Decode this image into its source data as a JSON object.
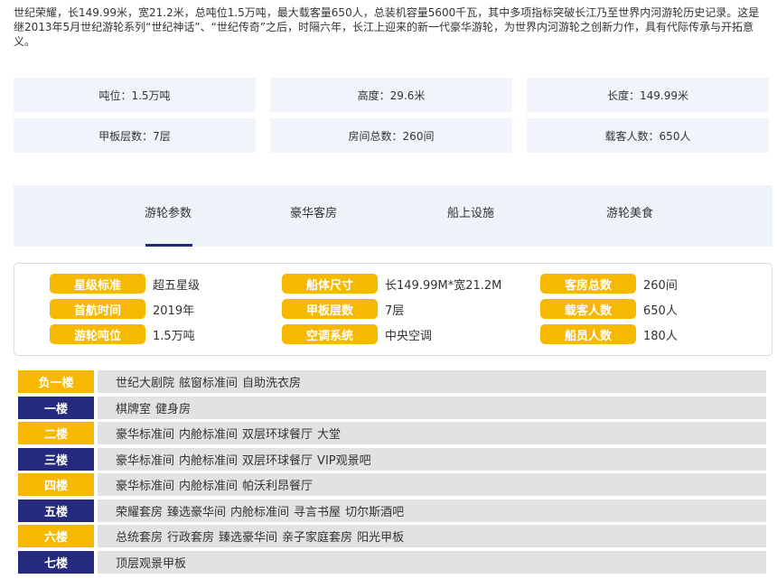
{
  "intro": {
    "text": "世纪荣耀，长149.99米，宽21.2米，总吨位1.5万吨，最大载客量650人，总装机容量5600千瓦，其中多项指标突破长江乃至世界内河游轮历史记录。这是继2013年5月世纪游轮系列“世纪神话”、“世纪传奇”之后，时隔六年，长江上迎来的新一代豪华游轮，为世界内河游轮之创新力作，具有代际传承与开拓意义。"
  },
  "stats": [
    "吨位：1.5万吨",
    "高度：29.6米",
    "长度：149.99米",
    "甲板层数：7层",
    "房间总数：260间",
    "载客人数：650人"
  ],
  "tabs": [
    {
      "label": "游轮参数",
      "active": true
    },
    {
      "label": "豪华客房",
      "active": false
    },
    {
      "label": "船上设施",
      "active": false
    },
    {
      "label": "游轮美食",
      "active": false
    }
  ],
  "specs": [
    {
      "label": "星级标准",
      "value": "超五星级"
    },
    {
      "label": "船体尺寸",
      "value": "长149.99M*宽21.2M"
    },
    {
      "label": "客房总数",
      "value": "260间"
    },
    {
      "label": "首航时间",
      "value": "2019年"
    },
    {
      "label": "甲板层数",
      "value": "7层"
    },
    {
      "label": "载客人数",
      "value": "650人"
    },
    {
      "label": "游轮吨位",
      "value": "1.5万吨"
    },
    {
      "label": "空调系统",
      "value": "中央空调"
    },
    {
      "label": "船员人数",
      "value": "180人"
    }
  ],
  "colors": {
    "gold": "#f6b800",
    "navy": "#252a7e",
    "tab_bg": "#eef3fa",
    "stat_bg": "#f1f5fb",
    "row_bg": "#e2e2e2"
  },
  "decks": [
    {
      "floor": "负一楼",
      "color": "#f6b800",
      "rooms": [
        "世纪大剧院",
        "舷窗标准间",
        "自助洗衣房"
      ]
    },
    {
      "floor": "一楼",
      "color": "#252a7e",
      "rooms": [
        "棋牌室",
        "健身房"
      ]
    },
    {
      "floor": "二楼",
      "color": "#f6b800",
      "rooms": [
        "豪华标准间",
        "内舱标准间",
        "双层环球餐厅",
        "大堂"
      ]
    },
    {
      "floor": "三楼",
      "color": "#252a7e",
      "rooms": [
        "豪华标准间",
        "内舱标准间",
        "双层环球餐厅",
        "VIP观景吧"
      ]
    },
    {
      "floor": "四楼",
      "color": "#f6b800",
      "rooms": [
        "豪华标准间",
        "内舱标准间",
        "帕沃利昂餐厅"
      ]
    },
    {
      "floor": "五楼",
      "color": "#252a7e",
      "rooms": [
        "荣耀套房",
        "臻选豪华间",
        "内舱标准间",
        "寻言书屋",
        "切尔斯酒吧"
      ]
    },
    {
      "floor": "六楼",
      "color": "#f6b800",
      "rooms": [
        "总统套房",
        "行政套房",
        "臻选豪华间",
        "亲子家庭套房",
        "阳光甲板"
      ]
    },
    {
      "floor": "七楼",
      "color": "#252a7e",
      "rooms": [
        "顶层观景甲板"
      ]
    }
  ]
}
